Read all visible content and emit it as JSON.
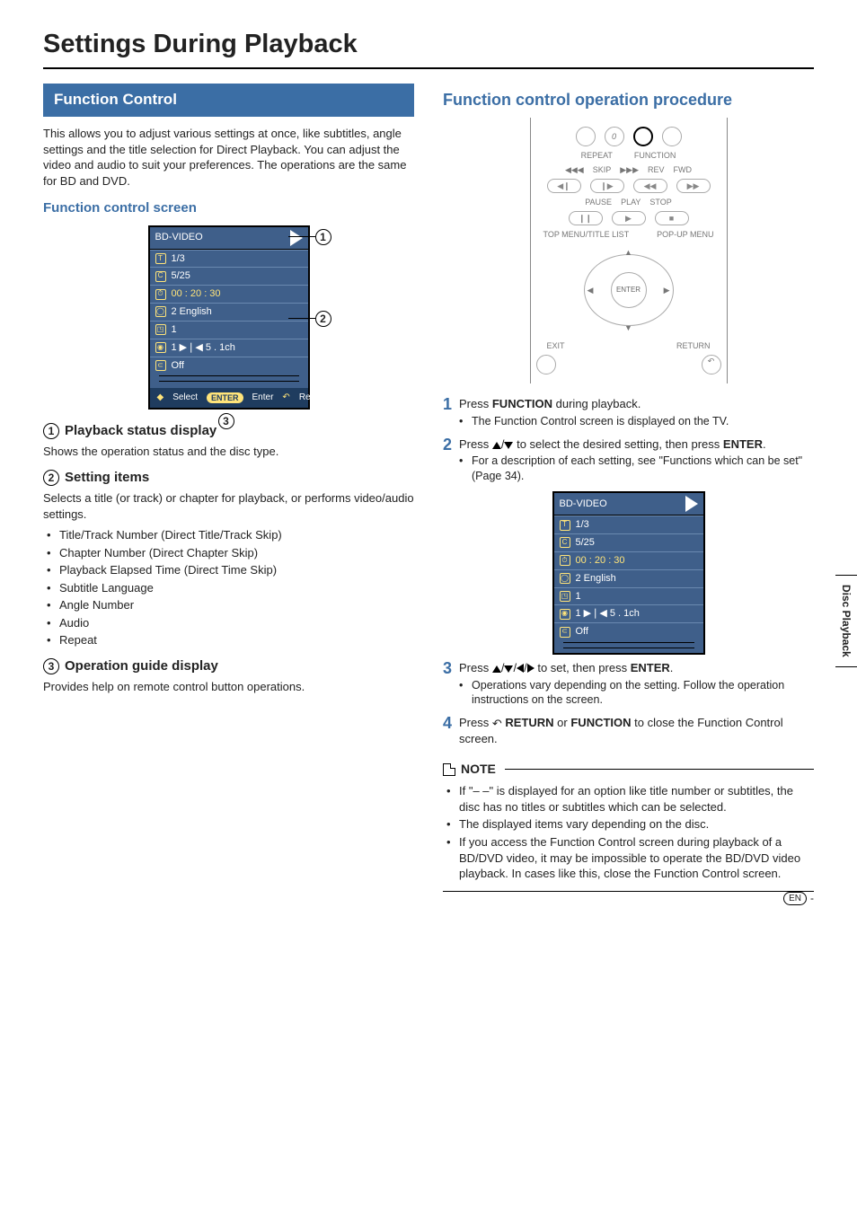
{
  "title": "Settings During Playback",
  "side_tab": "Disc Playback",
  "footer": {
    "lang": "EN",
    "dash": "-"
  },
  "left": {
    "band": "Function Control",
    "lead": "This allows you to adjust various settings at once, like subtitles, angle settings and the title selection for Direct Playback. You can adjust the video and audio to suit your preferences. The operations are the same for BD and DVD.",
    "screen_head": "Function control screen",
    "callouts": {
      "c1": "1",
      "c2": "2",
      "c3": "3"
    },
    "s1": {
      "num": "1",
      "title": "Playback status display",
      "body": "Shows the operation status and the disc type."
    },
    "s2": {
      "num": "2",
      "title": "Setting items",
      "body": "Selects a title (or track) or chapter for playback, or performs video/audio settings.",
      "items": [
        "Title/Track Number (Direct Title/Track Skip)",
        "Chapter Number (Direct Chapter Skip)",
        "Playback Elapsed Time (Direct Time Skip)",
        "Subtitle Language",
        "Angle Number",
        "Audio",
        "Repeat"
      ]
    },
    "s3": {
      "num": "3",
      "title": "Operation guide display",
      "body": "Provides help on remote control button operations."
    }
  },
  "panel": {
    "header": "BD-VIDEO",
    "rows": [
      {
        "icon": "T",
        "text": "1/3"
      },
      {
        "icon": "C",
        "text": "5/25"
      },
      {
        "icon": "⏱",
        "text": "00 : 20 : 30",
        "hl": true
      },
      {
        "icon": "◯",
        "text": "2 English"
      },
      {
        "icon": "◳",
        "text": "1"
      },
      {
        "icon": "◉",
        "text": "1   ▶❘◀   5 . 1ch"
      },
      {
        "icon": "⊂",
        "text": "Off"
      }
    ],
    "guide": {
      "select": "Select",
      "enter_pill": "ENTER",
      "enter": "Enter",
      "return": "Return"
    }
  },
  "right": {
    "heading": "Function control operation procedure",
    "remote": {
      "row1": [
        "REPEAT",
        "0",
        "FUNCTION"
      ],
      "skip": "SKIP",
      "rev": "REV",
      "fwd": "FWD",
      "pause": "PAUSE",
      "play": "PLAY",
      "stop": "STOP",
      "tl": "TOP MENU/TITLE LIST",
      "pm": "POP-UP MENU",
      "enter": "ENTER",
      "exit": "EXIT",
      "return": "RETURN"
    },
    "steps": [
      {
        "n": "1",
        "main_pre": "Press ",
        "k1": "FUNCTION",
        "main_post": " during playback.",
        "bul": [
          "The Function Control screen is displayed on the TV."
        ]
      },
      {
        "n": "2",
        "main_pre": "Press ",
        "arrows": "ud",
        "main_mid": " to select the desired setting, then press ",
        "k1": "ENTER",
        "main_post": ".",
        "bul": [
          "For a description of each setting, see \"Functions which can be set\" (Page 34)."
        ]
      },
      {
        "n": "3",
        "main_pre": "Press ",
        "arrows": "udlr",
        "main_mid": " to set, then press ",
        "k1": "ENTER",
        "main_post": ".",
        "bul": [
          "Operations vary depending on the setting. Follow the operation instructions on the screen."
        ]
      },
      {
        "n": "4",
        "main_pre": "Press ",
        "ret": true,
        "k1": "RETURN",
        "or": " or ",
        "k2": "FUNCTION",
        "main_post": " to close the Function Control screen."
      }
    ],
    "note_label": "NOTE",
    "notes": [
      "If \"– –\" is displayed for an option like title number or subtitles, the disc has no titles or subtitles which can be selected.",
      "The displayed items vary depending on the disc.",
      "If you access the Function Control screen during playback of a BD/DVD video, it may be impossible to operate the BD/DVD video playback. In cases like this, close the Function Control screen."
    ]
  }
}
